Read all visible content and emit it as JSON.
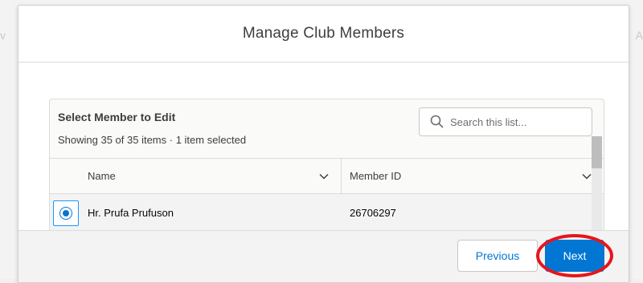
{
  "modal": {
    "title": "Manage Club Members"
  },
  "card": {
    "title": "Select Member to Edit",
    "meta": "Showing 35 of 35 items · 1 item selected",
    "search": {
      "placeholder": "Search this list...",
      "icon": "search-icon"
    }
  },
  "table": {
    "columns": [
      {
        "label": "Name",
        "icon": "chevron-down-icon"
      },
      {
        "label": "Member ID",
        "icon": "chevron-down-icon"
      }
    ],
    "rows": [
      {
        "selected": true,
        "name": "Hr. Prufa Prufuson",
        "member_id": "26706297"
      }
    ]
  },
  "footer": {
    "previous_label": "Previous",
    "next_label": "Next"
  },
  "colors": {
    "brand": "#0176d3",
    "highlight": "#e8141c"
  }
}
